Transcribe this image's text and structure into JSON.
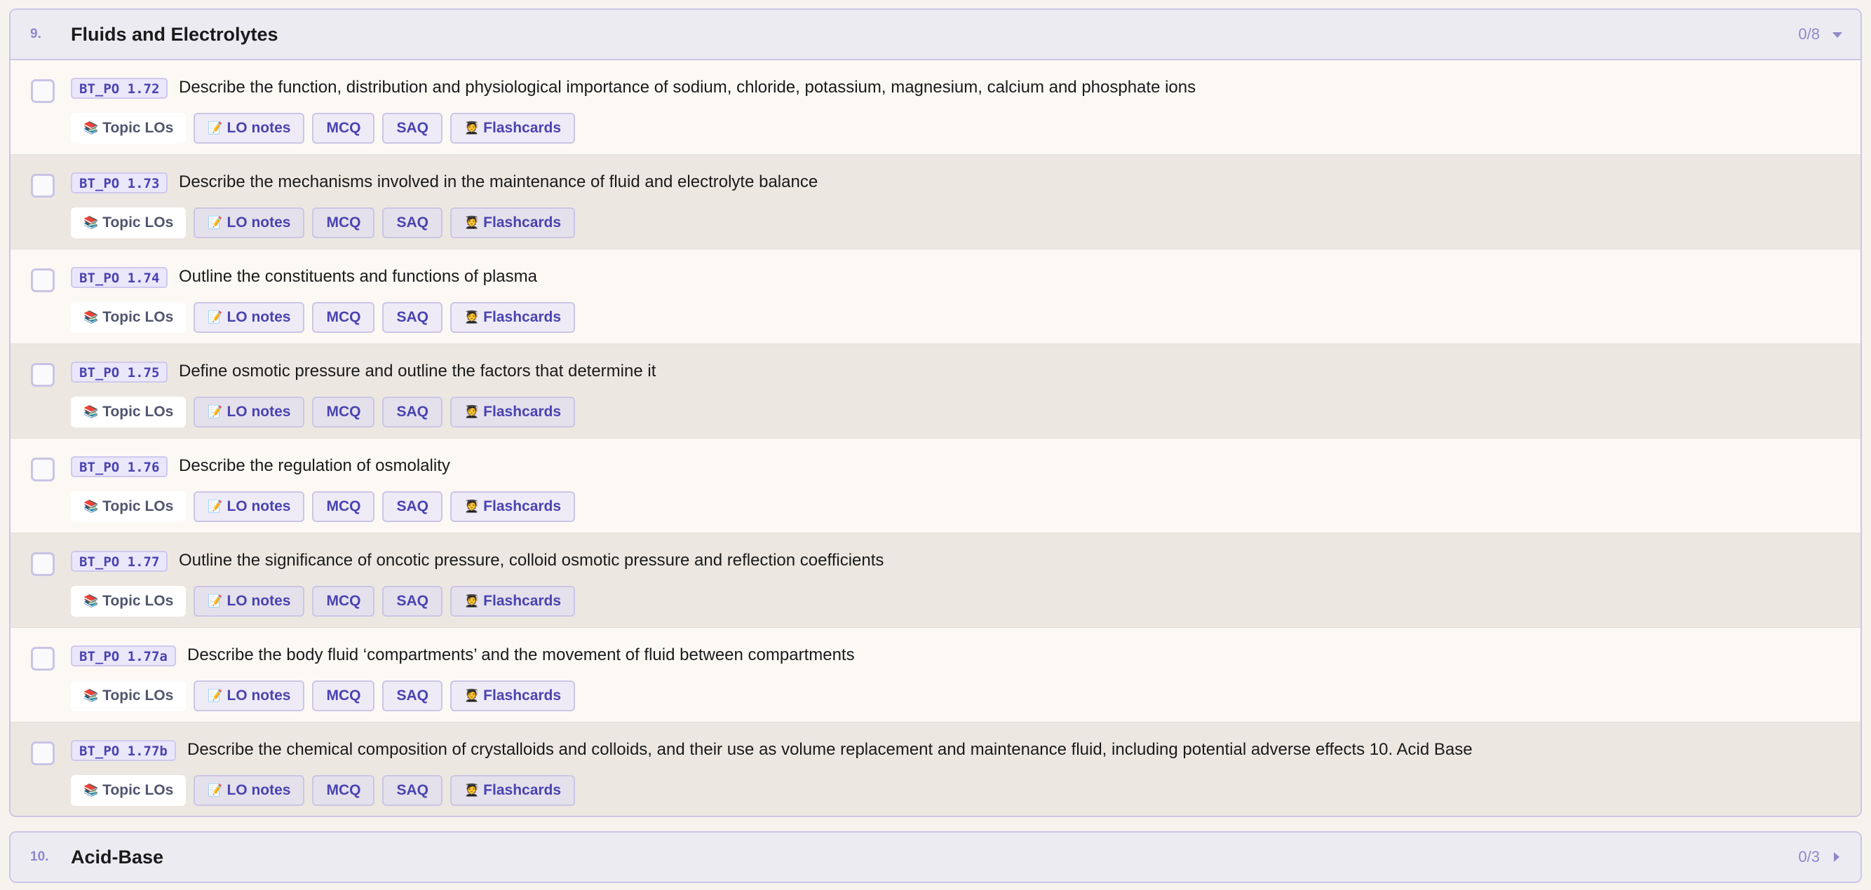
{
  "sections": [
    {
      "num": "9.",
      "title": "Fluids and Electrolytes",
      "count": "0/8",
      "expanded": true
    },
    {
      "num": "10.",
      "title": "Acid-Base",
      "count": "0/3",
      "expanded": false
    }
  ],
  "tag_labels": {
    "topic": "Topic LOs",
    "notes": "LO notes",
    "mcq": "MCQ",
    "saq": "SAQ",
    "flashcards": "Flashcards"
  },
  "icons": {
    "topic": "books-icon",
    "notes": "memo-icon",
    "flashcards": "student-icon"
  },
  "items": [
    {
      "code": "BT_PO 1.72",
      "text": "Describe the function, distribution and physiological importance of sodium, chloride, potassium, magnesium, calcium and phosphate ions"
    },
    {
      "code": "BT_PO 1.73",
      "text": "Describe the mechanisms involved in the maintenance of fluid and electrolyte balance"
    },
    {
      "code": "BT_PO 1.74",
      "text": "Outline the constituents and functions of plasma"
    },
    {
      "code": "BT_PO 1.75",
      "text": "Define osmotic pressure and outline the factors that determine it"
    },
    {
      "code": "BT_PO 1.76",
      "text": "Describe the regulation of osmolality"
    },
    {
      "code": "BT_PO 1.77",
      "text": "Outline the significance of oncotic pressure, colloid osmotic pressure and reflection coefficients"
    },
    {
      "code": "BT_PO 1.77a",
      "text": "Describe the body fluid ‘compartments’ and the movement of fluid between compartments"
    },
    {
      "code": "BT_PO 1.77b",
      "text": "Describe the chemical composition of crystalloids and colloids, and their use as volume replacement and maintenance fluid, including potential adverse effects 10. Acid Base"
    }
  ],
  "colors": {
    "accent": "#4a43b0",
    "header_bg": "#ecebf2",
    "border": "#cbc6e6",
    "row_alt": "#ece8e1"
  }
}
